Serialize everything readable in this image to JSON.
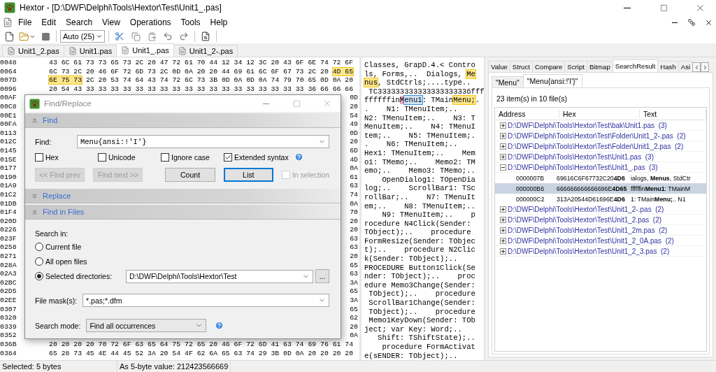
{
  "window": {
    "title": "Hextor - [D:\\DWF\\Delphi\\Tools\\Hextor\\Test\\Unit1_.pas]"
  },
  "menu": [
    "File",
    "Edit",
    "Search",
    "View",
    "Operations",
    "Tools",
    "Help"
  ],
  "toolbar": {
    "combo_value": "Auto (25)"
  },
  "file_tabs": [
    {
      "label": "Unit1_2.pas",
      "selected": false
    },
    {
      "label": "Unit1.pas",
      "selected": false
    },
    {
      "label": "Unit1_.pas",
      "selected": true
    },
    {
      "label": "Unit1_2-.pas",
      "selected": false
    }
  ],
  "hex_rows": [
    {
      "address": "0048",
      "segments": [
        {
          "text": "43 6C 61 73 73 65 73 2C 20 47 72 61 70 44 12 34 12 3C 20 43 6F 6E 74 72 6F",
          "highlighted": false
        }
      ]
    },
    {
      "address": "0064",
      "segments": [
        {
          "text": "6C 73 2C 20 46 6F 72 6D 73 2C 0D 0A 20 20 44 69 61 6C 6F 67 73 2C 20",
          "highlighted": false
        },
        {
          "text": "4D 65",
          "highlighted": true
        }
      ]
    },
    {
      "address": "007D",
      "segments": [
        {
          "text": "6E 75 73",
          "highlighted": true
        },
        {
          "text": "2C 20 53 74 64 43 74 72 6C 73 3B 0D 0A 0D 0A 74 79 70 65 0D 0A 20",
          "highlighted": false
        }
      ]
    },
    {
      "address": "0096",
      "segments": [
        {
          "text": "20 54 43 33 33 33 33 33 33 33 33 33 33 33 33 33 33 33 33 33 33 36 66 66 66",
          "highlighted": false
        }
      ]
    },
    {
      "address": "00AF",
      "tail": "0D"
    },
    {
      "address": "00C8",
      "tail": "20"
    },
    {
      "address": "00E1",
      "tail": "54"
    },
    {
      "address": "00FA",
      "tail": "49"
    },
    {
      "address": "0113",
      "tail": "0D"
    },
    {
      "address": "012C",
      "tail": "20"
    },
    {
      "address": "0145",
      "tail": "6D"
    },
    {
      "address": "015E",
      "tail": "4D"
    },
    {
      "address": "0177",
      "tail": "0A"
    },
    {
      "address": "0190",
      "tail": "61"
    },
    {
      "address": "01A9",
      "tail": "63"
    },
    {
      "address": "01C2",
      "tail": "74"
    },
    {
      "address": "01DB",
      "tail": "0A"
    },
    {
      "address": "01F4",
      "tail": "70"
    },
    {
      "address": "020D",
      "tail": "20"
    },
    {
      "address": "0226",
      "tail": "20"
    },
    {
      "address": "023F",
      "tail": "63"
    },
    {
      "address": "0258",
      "tail": "63"
    },
    {
      "address": "0271",
      "tail": "20"
    },
    {
      "address": "028A",
      "tail": "65"
    },
    {
      "address": "02A3",
      "tail": "63"
    },
    {
      "address": "02BC",
      "tail": "3A"
    },
    {
      "address": "02D5",
      "tail": "65"
    },
    {
      "address": "02EE",
      "tail": "3A"
    },
    {
      "address": "0307",
      "tail": "65"
    },
    {
      "address": "0320",
      "tail": "62"
    },
    {
      "address": "0339",
      "tail": "20"
    },
    {
      "address": "0352",
      "tail": "0A"
    },
    {
      "address": "036B",
      "segments": [
        {
          "text": "20 20 20 20 70 72 6F 63 65 64 75 72 65 20 46 6F 72 6D 41 63 74 69 76 61 74",
          "highlighted": false
        }
      ]
    },
    {
      "address": "0384",
      "segments": [
        {
          "text": "65 28 73 45 4E 44 45 52 3A 20 54 4F 62 6A 65 63 74 29 3B 0D 0A 20 20 20 20",
          "highlighted": false
        }
      ]
    }
  ],
  "text_lines": [
    {
      "text": "Classes, GrapD.4.< Contro"
    },
    {
      "segments": [
        {
          "text": "ls, Forms,..  Dialogs, ",
          "match": false,
          "cursor": false,
          "selected": false
        },
        {
          "text": "Me",
          "match": true,
          "cursor": false,
          "selected": false
        }
      ]
    },
    {
      "segments": [
        {
          "text": "nus",
          "match": true,
          "cursor": false,
          "selected": false
        },
        {
          "text": ", StdCtrls;....type.. ",
          "match": false,
          "cursor": false,
          "selected": false
        }
      ]
    },
    {
      "text": " TC333333333333333333336fff"
    },
    {
      "segments": [
        {
          "text": "ffffffin",
          "match": false,
          "cursor": false,
          "selected": false
        },
        {
          "text": "M",
          "match": false,
          "cursor": true,
          "selected": false
        },
        {
          "text": "enu1",
          "match": false,
          "cursor": false,
          "selected": true
        },
        {
          "text": ": TMain",
          "match": false,
          "cursor": false,
          "selected": false
        },
        {
          "text": "Menu;",
          "match": true,
          "cursor": false,
          "selected": false
        },
        {
          "text": ".",
          "match": false,
          "cursor": false,
          "selected": false
        }
      ]
    },
    {
      "text": ".    N1: TMenuItem;.."
    },
    {
      "text": "N2: TMenuItem;..    N3: T"
    },
    {
      "text": "MenuItem;..    N4: TMenuI"
    },
    {
      "text": "tem;..    N5: TMenuItem;."
    },
    {
      "text": ".    N6: TMenuItem;.."
    },
    {
      "text": "Hex1: TMenuItem;..    Mem"
    },
    {
      "text": "o1: TMemo;..    Memo2: TM"
    },
    {
      "text": "emo;..    Memo3: TMemo;.."
    },
    {
      "text": "    OpenDialog1: TOpenDia"
    },
    {
      "text": "log;..    ScrollBar1: TSc"
    },
    {
      "text": "rollBar;..    N7: TMenuIt"
    },
    {
      "text": "em;..    N8: TMenuItem;.."
    },
    {
      "text": "    N9: TMenuItem;..    p"
    },
    {
      "text": "rocedure N4Click(Sender:"
    },
    {
      "text": "TObject);..    procedure"
    },
    {
      "text": "FormResize(Sender: TObjec"
    },
    {
      "text": "t);..    procedure N2Clic"
    },
    {
      "text": "k(Sender: TObject);.."
    },
    {
      "text": "PROCEDURE Button1Click(Se"
    },
    {
      "text": "nder: TObject);..    proc"
    },
    {
      "text": "edure Memo3Change(Sender:"
    },
    {
      "text": " TObject);..    procedure"
    },
    {
      "text": " ScrollBar1Change(Sender:"
    },
    {
      "text": " TObject);..    procedure"
    },
    {
      "text": " Memo1KeyDown(Sender: TOb"
    },
    {
      "text": "ject; var Key: Word;.."
    },
    {
      "text": "   Shift: TShiftState);.."
    },
    {
      "text": "    procedure FormActivat"
    },
    {
      "text": "e(sENDER: TObject);.."
    }
  ],
  "dialog": {
    "title": "Find/Replace",
    "find": {
      "title": "Find",
      "expanded": true,
      "find_label": "Find:",
      "find_value": "Menu{ansi:!'I'}",
      "options": [
        {
          "label": "Hex",
          "checked": false
        },
        {
          "label": "Unicode",
          "checked": false
        },
        {
          "label": "Ignore case",
          "checked": false
        },
        {
          "label": "Extended syntax",
          "checked": true
        }
      ],
      "buttons": [
        {
          "label": "<< Find prev",
          "disabled": true,
          "focused": false
        },
        {
          "label": "Find next >>",
          "disabled": true,
          "focused": false
        },
        {
          "label": "Count",
          "disabled": false,
          "focused": false
        },
        {
          "label": "List",
          "disabled": false,
          "focused": true
        }
      ],
      "in_selection": {
        "label": "In selection",
        "checked": false,
        "disabled": true
      }
    },
    "replace": {
      "title": "Replace",
      "expanded": false
    },
    "files": {
      "title": "Find in Files",
      "expanded": true,
      "search_in_label": "Search in:",
      "scopes": [
        {
          "label": "Current file",
          "selected": false
        },
        {
          "label": "All open files",
          "selected": false
        },
        {
          "label": "Selected directories:",
          "selected": true
        }
      ],
      "directory": "D:\\DWF\\Delphi\\Tools\\Hextor\\Test",
      "browse_label": "...",
      "mask_label": "File mask(s):",
      "mask_value": "*.pas;*.dfm",
      "mode_label": "Search mode:",
      "mode_value": "Find all occurrences"
    }
  },
  "right_panel": {
    "tabs": [
      {
        "label": "Value",
        "selected": false
      },
      {
        "label": "Struct",
        "selected": false
      },
      {
        "label": "Compare",
        "selected": false
      },
      {
        "label": "Script",
        "selected": false
      },
      {
        "label": "Bitmap",
        "selected": false
      },
      {
        "label": "SearchResult",
        "selected": true
      },
      {
        "label": "Hash",
        "selected": false
      },
      {
        "label": "Asi",
        "selected": false
      }
    ],
    "subtabs": [
      {
        "label": "\"Menu\"",
        "selected": false
      },
      {
        "label": "\"Menu{ansi:!'I'}\"",
        "selected": true
      }
    ],
    "summary": "23 item(s) in 10 file(s)",
    "columns": [
      "Address",
      "Hex",
      "Text"
    ],
    "items": [
      {
        "label": "D:\\DWF\\Delphi\\Tools\\Hextor\\Test\\bak\\Unit1.pas",
        "count": "(3)",
        "expanded": false
      },
      {
        "label": "D:\\DWF\\Delphi\\Tools\\Hextor\\Test\\Folder\\Unit1_2-.pas",
        "count": "(2)",
        "expanded": false
      },
      {
        "label": "D:\\DWF\\Delphi\\Tools\\Hextor\\Test\\Folder\\Unit1_2.pas",
        "count": "(2)",
        "expanded": false
      },
      {
        "label": "D:\\DWF\\Delphi\\Tools\\Hextor\\Test\\Unit1.pas",
        "count": "(3)",
        "expanded": false
      },
      {
        "label": "D:\\DWF\\Delphi\\Tools\\Hextor\\Test\\Unit1_.pas",
        "count": "(3)",
        "expanded": true,
        "children": [
          {
            "address": "0000007B",
            "hex": "69616C6F67732C20**4D6**",
            "text": "ialogs, **Menus**, StdCtr",
            "selected": false
          },
          {
            "address": "000000B6",
            "hex": "666666666666696E**4D65**",
            "text": "ffffffin**Menu1**: TMainM",
            "selected": true
          },
          {
            "address": "000000C2",
            "hex": "313A20544D61696E**4D6**",
            "text": "1: TMain**Menu;**..    N1",
            "selected": false
          }
        ]
      },
      {
        "label": "D:\\DWF\\Delphi\\Tools\\Hextor\\Test\\Unit1_2-.pas",
        "count": "(2)",
        "expanded": false
      },
      {
        "label": "D:\\DWF\\Delphi\\Tools\\Hextor\\Test\\Unit1_2.pas",
        "count": "(2)",
        "expanded": false
      },
      {
        "label": "D:\\DWF\\Delphi\\Tools\\Hextor\\Test\\Unit1_2m.pas",
        "count": "(2)",
        "expanded": false
      },
      {
        "label": "D:\\DWF\\Delphi\\Tools\\Hextor\\Test\\Unit1_2_0A.pas",
        "count": "(2)",
        "expanded": false
      },
      {
        "label": "D:\\DWF\\Delphi\\Tools\\Hextor\\Test\\Unit1_2_3.pas",
        "count": "(2)",
        "expanded": false
      }
    ]
  },
  "status": [
    "Selected: 5 bytes",
    "As 5-byte value: 212423566669"
  ]
}
